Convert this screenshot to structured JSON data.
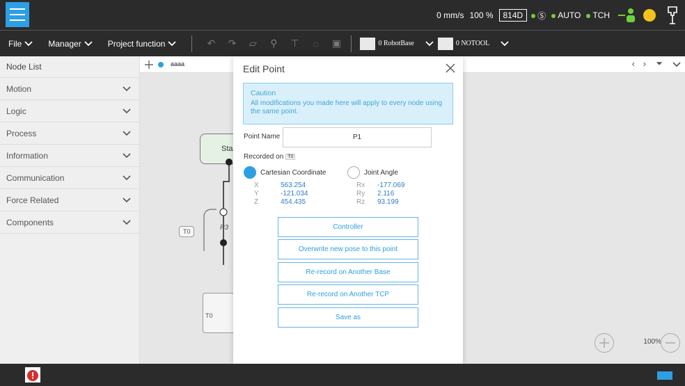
{
  "status": {
    "speed": "0 mm/s",
    "percent": "100 %",
    "id_badge": "814D",
    "auto": "AUTO",
    "tcp": "TCH"
  },
  "menu": {
    "file": "File",
    "manager": "Manager",
    "project": "Project function"
  },
  "selectors": {
    "base": "0 RobotBase",
    "tool": "0 NOTOOL"
  },
  "sidebar": {
    "title": "Node List",
    "items": [
      {
        "label": "Motion"
      },
      {
        "label": "Logic"
      },
      {
        "label": "Process"
      },
      {
        "label": "Information"
      },
      {
        "label": "Communication"
      },
      {
        "label": "Force Related"
      },
      {
        "label": "Components"
      }
    ]
  },
  "canvas": {
    "tab": "aaaa",
    "start_label": "Sta",
    "p3_label": "P3",
    "t0_a": "T0",
    "t0_b": "T0",
    "zoom": "100%"
  },
  "modal": {
    "title": "Edit Point",
    "caution_title": "Caution",
    "caution_text": "All modifications you made here will apply to every node using the same point.",
    "point_name_label": "Point Name",
    "point_name_value": "P1",
    "recorded_label": "Recorded on",
    "recorded_chip": "T0",
    "radio_cartesian": "Cartesian Coordinate",
    "radio_joint": "Joint Angle",
    "coords": {
      "x_label": "X",
      "x": "563.254",
      "y_label": "Y",
      "y": "-121.034",
      "z_label": "Z",
      "z": "454.435",
      "rx_label": "Rx",
      "rx": "-177.069",
      "ry_label": "Ry",
      "ry": "2.116",
      "rz_label": "Rz",
      "rz": "93.199"
    },
    "buttons": {
      "controller": "Controller",
      "overwrite": "Overwrite new pose to this point",
      "rerecord_base": "Re-record on Another Base",
      "rerecord_tcp": "Re-record on Another TCP",
      "save_as": "Save as"
    }
  },
  "colors": {
    "accent": "#2d9fe3",
    "bar": "#2b2b2b",
    "caution_bg": "#d9f0fb"
  }
}
